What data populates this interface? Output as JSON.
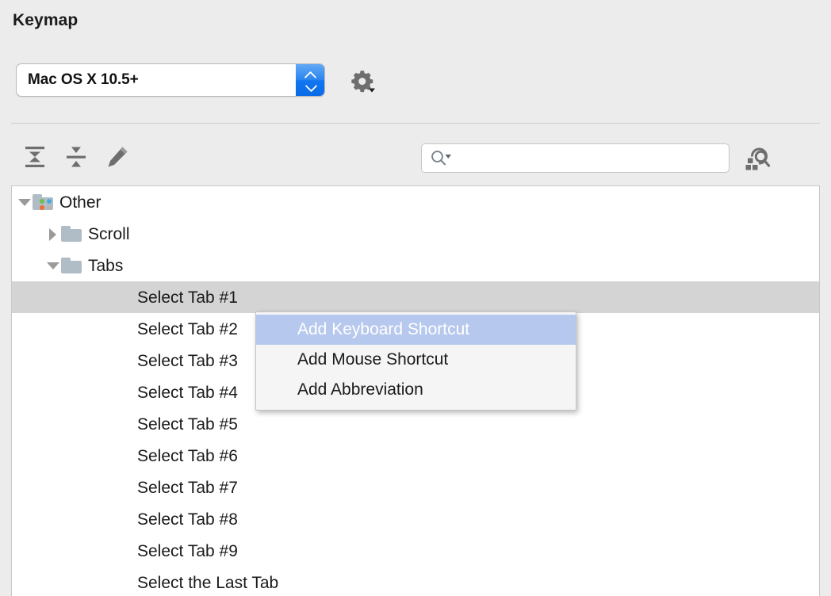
{
  "page": {
    "title": "Keymap"
  },
  "keymap": {
    "selected": "Mac OS X 10.5+",
    "stepper_icon": "stepper-updown-icon",
    "gear_icon": "gear-dropdown-icon"
  },
  "toolbar": {
    "expand_all_icon": "expand-all-icon",
    "collapse_all_icon": "collapse-all-icon",
    "edit_icon": "pencil-edit-icon",
    "search_icon": "search-dropdown-icon",
    "search_placeholder": "",
    "search_value": "",
    "find_shortcut_icon": "find-by-shortcut-icon"
  },
  "tree": {
    "nodes": [
      {
        "label": "Other",
        "level": 0,
        "expanded": true,
        "type": "folder-colored",
        "selected": false
      },
      {
        "label": "Scroll",
        "level": 1,
        "expanded": false,
        "type": "folder",
        "selected": false
      },
      {
        "label": "Tabs",
        "level": 1,
        "expanded": true,
        "type": "folder",
        "selected": false
      },
      {
        "label": "Select Tab #1",
        "level": 2,
        "type": "action",
        "selected": true
      },
      {
        "label": "Select Tab #2",
        "level": 2,
        "type": "action",
        "selected": false
      },
      {
        "label": "Select Tab #3",
        "level": 2,
        "type": "action",
        "selected": false
      },
      {
        "label": "Select Tab #4",
        "level": 2,
        "type": "action",
        "selected": false
      },
      {
        "label": "Select Tab #5",
        "level": 2,
        "type": "action",
        "selected": false
      },
      {
        "label": "Select Tab #6",
        "level": 2,
        "type": "action",
        "selected": false
      },
      {
        "label": "Select Tab #7",
        "level": 2,
        "type": "action",
        "selected": false
      },
      {
        "label": "Select Tab #8",
        "level": 2,
        "type": "action",
        "selected": false
      },
      {
        "label": "Select Tab #9",
        "level": 2,
        "type": "action",
        "selected": false
      },
      {
        "label": "Select the Last Tab",
        "level": 2,
        "type": "action",
        "selected": false
      }
    ]
  },
  "context_menu": {
    "items": [
      {
        "label": "Add Keyboard Shortcut",
        "highlighted": true
      },
      {
        "label": "Add Mouse Shortcut",
        "highlighted": false
      },
      {
        "label": "Add Abbreviation",
        "highlighted": false
      }
    ]
  },
  "colors": {
    "background": "#ececec",
    "panel": "#ffffff",
    "selection_row": "#d4d4d4",
    "menu_highlight": "#b7c8ee",
    "stepper_blue": "#1177ef",
    "folder": "#b0bcc6",
    "icon_gray": "#6e6e6e",
    "dot_green": "#6fbf4a",
    "dot_blue": "#4aa8e0",
    "dot_orange": "#ef6c2a",
    "dot_gray": "#b5b5b5"
  }
}
